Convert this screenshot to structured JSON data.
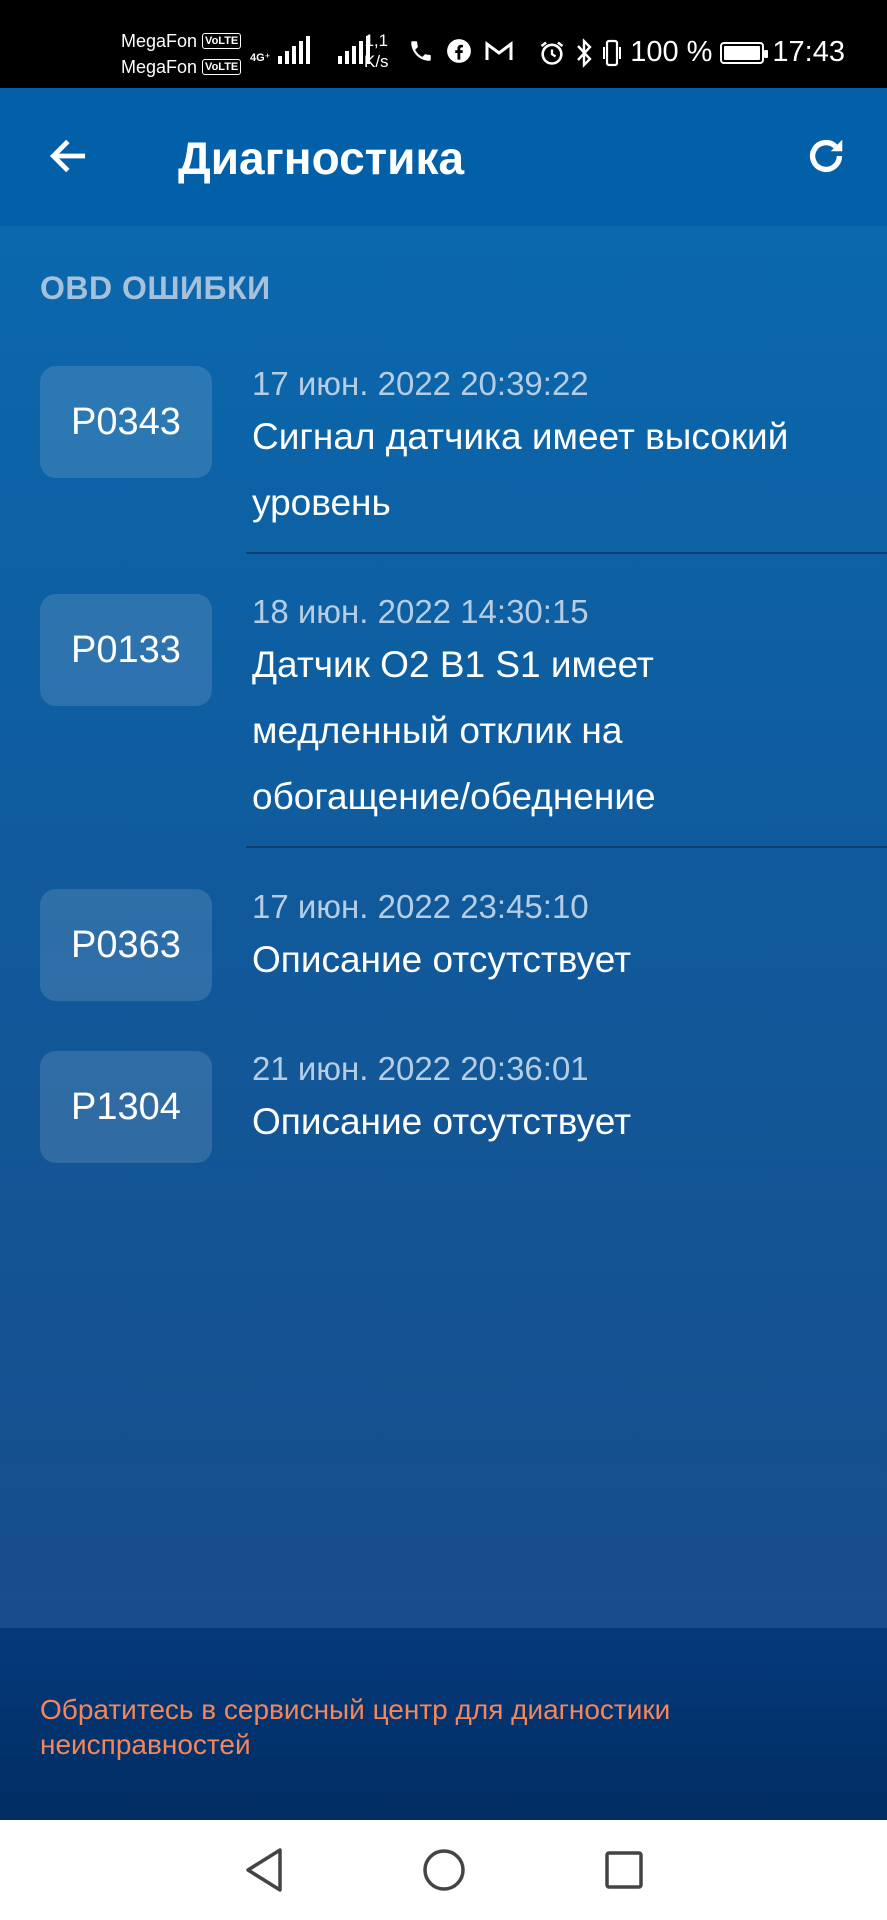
{
  "status_bar": {
    "carrier1": "MegaFon",
    "carrier2": "MegaFon",
    "volte": "VoLTE",
    "network_type": "4G⁺",
    "net_speed_value": "1,1",
    "net_speed_unit": "K/s",
    "battery": "100 %",
    "time": "17:43"
  },
  "header": {
    "title": "Диагностика"
  },
  "main": {
    "section_title": "OBD ОШИБКИ",
    "errors": [
      {
        "code": "P0343",
        "date": "17 июн. 2022 20:39:22",
        "description": "Сигнал датчика имеет высокий уровень"
      },
      {
        "code": "P0133",
        "date": "18 июн. 2022 14:30:15",
        "description": "Датчик O2 B1 S1 имеет медленный отклик на обогащение/обеднение"
      },
      {
        "code": "P0363",
        "date": "17 июн. 2022 23:45:10",
        "description": "Описание отсутствует"
      },
      {
        "code": "P1304",
        "date": "21 июн. 2022 20:36:01",
        "description": "Описание отсутствует"
      }
    ]
  },
  "notice": {
    "text": "Обратитесь в сервисный центр для диагностики неисправностей"
  },
  "colors": {
    "header_bg": "#0260a8",
    "accent_warning": "#f3865a",
    "section_title": "#a7c1da"
  }
}
